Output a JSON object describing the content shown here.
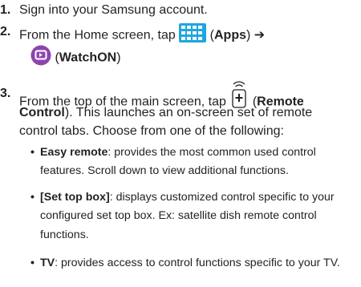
{
  "steps": [
    {
      "num": "1.",
      "text": "Sign into your Samsung account."
    },
    {
      "num": "2.",
      "pre": "From the Home screen, tap",
      "apps_label": "Apps",
      "arrow": "➔",
      "watchon_label": "WatchON",
      "open_paren": "(",
      "close_paren": ")"
    },
    {
      "num": "3.",
      "line1_pre": "From the top of the main screen, tap",
      "remote_label_part1": "Remote",
      "remote_label_part2": "Control",
      "line2_rest": "). This launches an on-screen set of remote",
      "line3": "control tabs. Choose from one of the following:",
      "open_paren": "("
    }
  ],
  "options": [
    {
      "bullet": "•",
      "term": "Easy remote",
      "lines": [
        ": provides the most common used control",
        "features. Scroll down to view additional functions."
      ]
    },
    {
      "bullet": "•",
      "term": "[Set top box]",
      "lines": [
        ": displays customized control specific to your",
        "configured set top box. Ex: satellite dish remote control",
        "functions."
      ]
    },
    {
      "bullet": "•",
      "term": "TV",
      "lines": [
        ": provides access to control functions specific to your TV."
      ]
    }
  ],
  "colors": {
    "apps_icon": "#1fa6e0",
    "watchon_icon": "#8e44ad",
    "text": "#231f20"
  },
  "icons": [
    "apps-grid-icon",
    "watchon-icon",
    "remote-control-icon"
  ]
}
